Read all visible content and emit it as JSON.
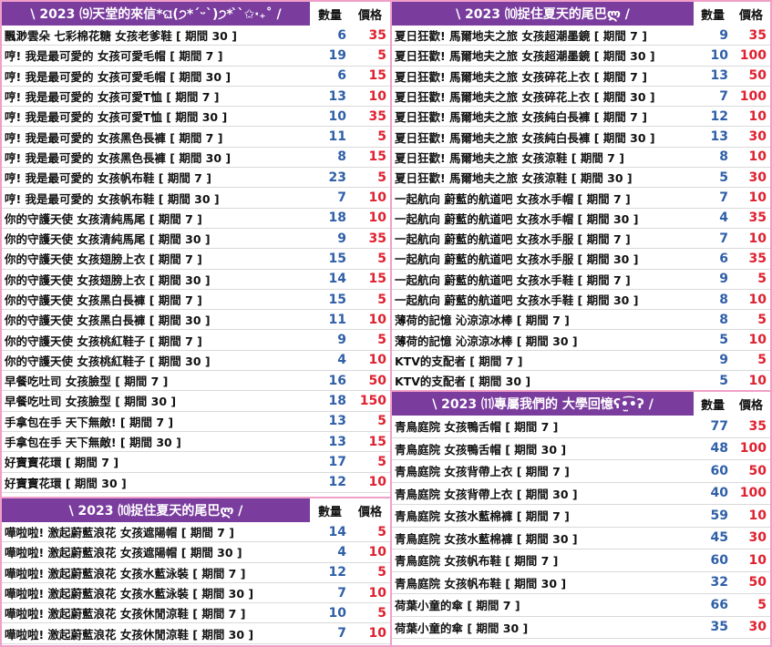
{
  "headers": {
    "qty": "數量",
    "price": "價格"
  },
  "panels": [
    {
      "id": "top-left",
      "title": "\\ 2023 ⑼天堂的來信*ଘ(੭*ˊᵕˋ)੭* ̀ˋ✩‧₊˚ /",
      "rows": [
        {
          "name": "飄渺雲朵 七彩棉花糖 女孩老爹鞋 [ 期間 30 ]",
          "qty": "6",
          "price": "35"
        },
        {
          "name": "哼! 我是最可愛的 女孩可愛毛帽 [ 期間 7 ]",
          "qty": "19",
          "price": "5"
        },
        {
          "name": "哼! 我是最可愛的 女孩可愛毛帽 [ 期間 30 ]",
          "qty": "6",
          "price": "15"
        },
        {
          "name": "哼! 我是最可愛的 女孩可愛T恤 [ 期間 7 ]",
          "qty": "13",
          "price": "10"
        },
        {
          "name": "哼! 我是最可愛的 女孩可愛T恤 [ 期間 30 ]",
          "qty": "10",
          "price": "35"
        },
        {
          "name": "哼! 我是最可愛的 女孩黑色長褲 [ 期間 7 ]",
          "qty": "11",
          "price": "5"
        },
        {
          "name": "哼! 我是最可愛的 女孩黑色長褲 [ 期間 30 ]",
          "qty": "8",
          "price": "15"
        },
        {
          "name": "哼! 我是最可愛的 女孩帆布鞋 [ 期間 7 ]",
          "qty": "23",
          "price": "5"
        },
        {
          "name": "哼! 我是最可愛的 女孩帆布鞋 [ 期間 30 ]",
          "qty": "7",
          "price": "10"
        },
        {
          "name": "你的守護天使 女孩清純馬尾 [ 期間 7 ]",
          "qty": "18",
          "price": "10"
        },
        {
          "name": "你的守護天使 女孩清純馬尾 [ 期間 30 ]",
          "qty": "9",
          "price": "35"
        },
        {
          "name": "你的守護天使 女孩翅膀上衣 [ 期間 7 ]",
          "qty": "15",
          "price": "5"
        },
        {
          "name": "你的守護天使 女孩翅膀上衣 [ 期間 30 ]",
          "qty": "14",
          "price": "15"
        },
        {
          "name": "你的守護天使 女孩黑白長褲 [ 期間 7 ]",
          "qty": "15",
          "price": "5"
        },
        {
          "name": "你的守護天使 女孩黑白長褲 [ 期間 30 ]",
          "qty": "11",
          "price": "10"
        },
        {
          "name": "你的守護天使 女孩桃紅鞋子 [ 期間 7 ]",
          "qty": "9",
          "price": "5"
        },
        {
          "name": "你的守護天使 女孩桃紅鞋子 [ 期間 30 ]",
          "qty": "4",
          "price": "10"
        },
        {
          "name": "早餐吃吐司 女孩臉型 [ 期間 7 ]",
          "qty": "16",
          "price": "50"
        },
        {
          "name": "早餐吃吐司 女孩臉型 [ 期間 30 ]",
          "qty": "18",
          "price": "150"
        },
        {
          "name": "手拿包在手 天下無敵! [ 期間 7 ]",
          "qty": "13",
          "price": "5"
        },
        {
          "name": "手拿包在手 天下無敵! [ 期間 30 ]",
          "qty": "13",
          "price": "15"
        },
        {
          "name": "好寶寶花環 [ 期間 7 ]",
          "qty": "17",
          "price": "5"
        },
        {
          "name": "好寶寶花環 [ 期間 30 ]",
          "qty": "12",
          "price": "10"
        }
      ]
    },
    {
      "id": "bottom-left",
      "title": "\\ 2023 ⑽捉住夏天的尾巴ლ /",
      "rows": [
        {
          "name": "嘩啦啦! 激起蔚藍浪花 女孩遮陽帽 [ 期間 7 ]",
          "qty": "14",
          "price": "5"
        },
        {
          "name": "嘩啦啦! 激起蔚藍浪花 女孩遮陽帽 [ 期間 30 ]",
          "qty": "4",
          "price": "10"
        },
        {
          "name": "嘩啦啦! 激起蔚藍浪花 女孩水藍泳裝 [ 期間 7 ]",
          "qty": "12",
          "price": "5"
        },
        {
          "name": "嘩啦啦! 激起蔚藍浪花 女孩水藍泳裝 [ 期間 30 ]",
          "qty": "7",
          "price": "10"
        },
        {
          "name": "嘩啦啦! 激起蔚藍浪花 女孩休閒涼鞋 [ 期間 7 ]",
          "qty": "10",
          "price": "5"
        },
        {
          "name": "嘩啦啦! 激起蔚藍浪花 女孩休閒涼鞋 [ 期間 30 ]",
          "qty": "7",
          "price": "10"
        }
      ]
    },
    {
      "id": "top-right",
      "title": "\\ 2023 ⑽捉住夏天的尾巴ლ /",
      "rows": [
        {
          "name": "夏日狂歡! 馬爾地夫之旅 女孩超潮墨鏡 [ 期間 7 ]",
          "qty": "9",
          "price": "35"
        },
        {
          "name": "夏日狂歡! 馬爾地夫之旅 女孩超潮墨鏡 [ 期間 30 ]",
          "qty": "10",
          "price": "100"
        },
        {
          "name": "夏日狂歡! 馬爾地夫之旅 女孩碎花上衣 [ 期間 7 ]",
          "qty": "13",
          "price": "50"
        },
        {
          "name": "夏日狂歡! 馬爾地夫之旅 女孩碎花上衣 [ 期間 30 ]",
          "qty": "7",
          "price": "100"
        },
        {
          "name": "夏日狂歡! 馬爾地夫之旅 女孩純白長褲 [ 期間 7 ]",
          "qty": "12",
          "price": "10"
        },
        {
          "name": "夏日狂歡! 馬爾地夫之旅 女孩純白長褲 [ 期間 30 ]",
          "qty": "13",
          "price": "30"
        },
        {
          "name": "夏日狂歡! 馬爾地夫之旅 女孩涼鞋 [ 期間 7 ]",
          "qty": "8",
          "price": "10"
        },
        {
          "name": "夏日狂歡! 馬爾地夫之旅 女孩涼鞋 [ 期間 30 ]",
          "qty": "5",
          "price": "30"
        },
        {
          "name": "一起航向 蔚藍的航道吧 女孩水手帽 [ 期間 7 ]",
          "qty": "7",
          "price": "10"
        },
        {
          "name": "一起航向 蔚藍的航道吧 女孩水手帽 [ 期間 30 ]",
          "qty": "4",
          "price": "35"
        },
        {
          "name": "一起航向 蔚藍的航道吧 女孩水手服 [ 期間 7 ]",
          "qty": "7",
          "price": "10"
        },
        {
          "name": "一起航向 蔚藍的航道吧 女孩水手服 [ 期間 30 ]",
          "qty": "6",
          "price": "35"
        },
        {
          "name": "一起航向 蔚藍的航道吧 女孩水手鞋 [ 期間 7 ]",
          "qty": "9",
          "price": "5"
        },
        {
          "name": "一起航向 蔚藍的航道吧 女孩水手鞋 [ 期間 30 ]",
          "qty": "8",
          "price": "10"
        },
        {
          "name": "薄荷的記憶 沁涼涼冰棒 [ 期間 7 ]",
          "qty": "8",
          "price": "5"
        },
        {
          "name": "薄荷的記憶 沁涼涼冰棒 [ 期間 30 ]",
          "qty": "5",
          "price": "10"
        },
        {
          "name": "KTV的支配者 [ 期間 7 ]",
          "qty": "9",
          "price": "5"
        },
        {
          "name": "KTV的支配者 [ 期間 30 ]",
          "qty": "5",
          "price": "10"
        }
      ]
    },
    {
      "id": "bottom-right",
      "title": "\\ 2023 ⑾專屬我們的 大學回憶ʕ•̫͡•ʔ /",
      "rows": [
        {
          "name": "青鳥庭院 女孩鴨舌帽 [ 期間 7 ]",
          "qty": "77",
          "price": "35"
        },
        {
          "name": "青鳥庭院 女孩鴨舌帽 [ 期間 30 ]",
          "qty": "48",
          "price": "100"
        },
        {
          "name": "青鳥庭院 女孩背帶上衣 [ 期間 7 ]",
          "qty": "60",
          "price": "50"
        },
        {
          "name": "青鳥庭院 女孩背帶上衣 [ 期間 30 ]",
          "qty": "40",
          "price": "100"
        },
        {
          "name": "青鳥庭院 女孩水藍棉褲 [ 期間 7 ]",
          "qty": "59",
          "price": "10"
        },
        {
          "name": "青鳥庭院 女孩水藍棉褲 [ 期間 30 ]",
          "qty": "45",
          "price": "30"
        },
        {
          "name": "青鳥庭院 女孩帆布鞋 [ 期間 7 ]",
          "qty": "60",
          "price": "10"
        },
        {
          "name": "青鳥庭院 女孩帆布鞋 [ 期間 30 ]",
          "qty": "32",
          "price": "50"
        },
        {
          "name": "荷葉小童的傘 [ 期間 7 ]",
          "qty": "66",
          "price": "5"
        },
        {
          "name": "荷葉小童的傘 [ 期間 30 ]",
          "qty": "35",
          "price": "30"
        }
      ]
    }
  ]
}
